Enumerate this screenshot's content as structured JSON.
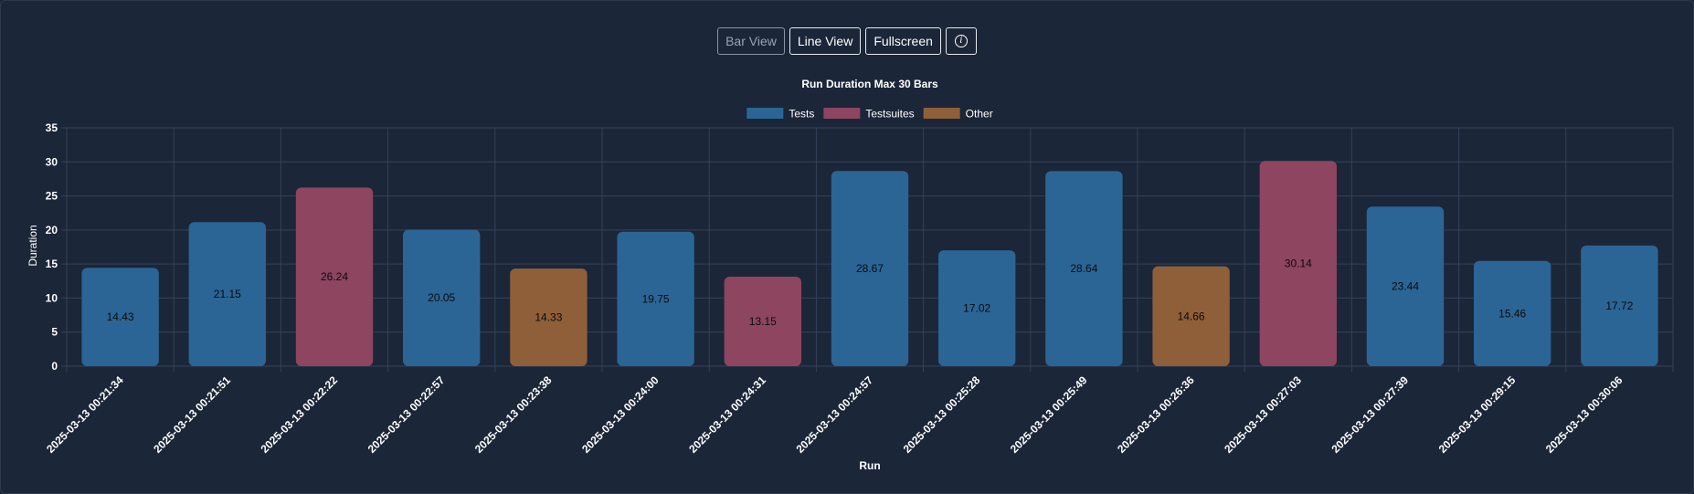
{
  "toolbar": {
    "bar_view": "Bar View",
    "line_view": "Line View",
    "fullscreen": "Fullscreen",
    "info_icon": "info-icon"
  },
  "colors": {
    "background": "#1b2638",
    "grid": "#34425a",
    "text": "#ffffff",
    "label": "#0b0b0b",
    "Tests": "#2b6595",
    "Testsuites": "#8d4560",
    "Other": "#8f5f39"
  },
  "chart_data": {
    "type": "bar",
    "title": "Run Duration Max 30 Bars",
    "xlabel": "Run",
    "ylabel": "Duration",
    "ylim": [
      0,
      35
    ],
    "yticks": [
      0,
      5,
      10,
      15,
      20,
      25,
      30,
      35
    ],
    "grid": true,
    "legend_position": "top-center",
    "legend": [
      "Tests",
      "Testsuites",
      "Other"
    ],
    "categories": [
      "2025-03-13 00:21:34",
      "2025-03-13 00:21:51",
      "2025-03-13 00:22:22",
      "2025-03-13 00:22:57",
      "2025-03-13 00:23:38",
      "2025-03-13 00:24:00",
      "2025-03-13 00:24:31",
      "2025-03-13 00:24:57",
      "2025-03-13 00:25:28",
      "2025-03-13 00:25:49",
      "2025-03-13 00:26:36",
      "2025-03-13 00:27:03",
      "2025-03-13 00:27:39",
      "2025-03-13 00:29:15",
      "2025-03-13 00:30:06"
    ],
    "values": [
      14.43,
      21.15,
      26.24,
      20.05,
      14.33,
      19.75,
      13.15,
      28.67,
      17.02,
      28.64,
      14.66,
      30.14,
      23.44,
      15.46,
      17.72
    ],
    "bar_types": [
      "Tests",
      "Tests",
      "Testsuites",
      "Tests",
      "Other",
      "Tests",
      "Testsuites",
      "Tests",
      "Tests",
      "Tests",
      "Other",
      "Testsuites",
      "Tests",
      "Tests",
      "Tests"
    ]
  }
}
